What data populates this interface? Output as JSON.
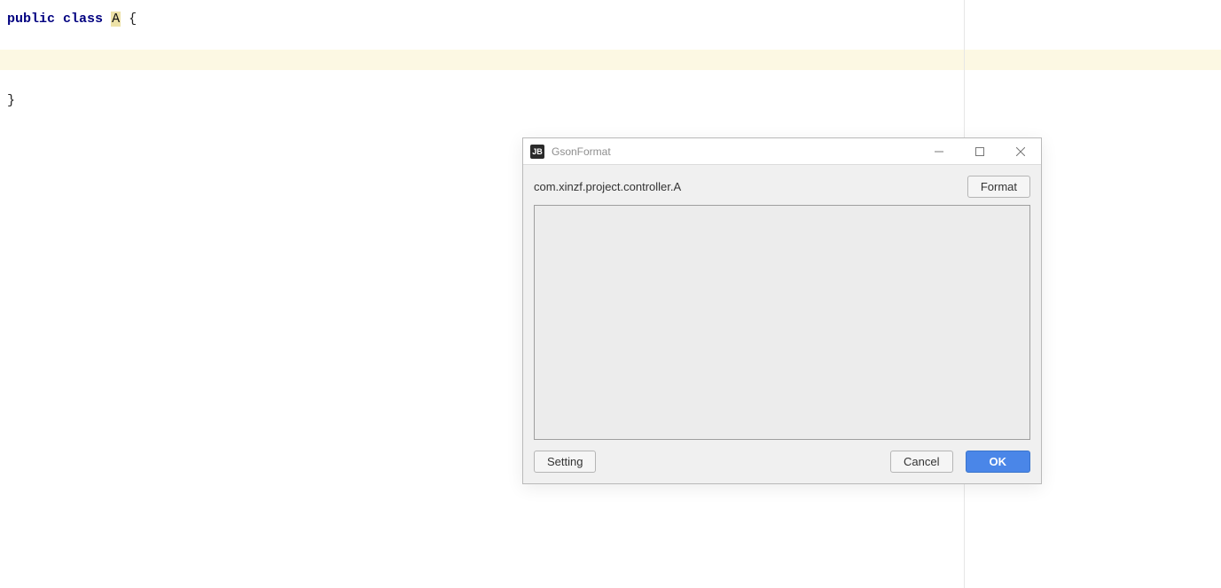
{
  "editor": {
    "line1_kw1": "public",
    "line1_kw2": "class",
    "line1_ident": "A",
    "line1_rest": " {",
    "line2": "",
    "line3": "",
    "line4": "",
    "line5": "}"
  },
  "dialog": {
    "icon_text": "JB",
    "title": "GsonFormat",
    "class_path": "com.xinzf.project.controller.A",
    "format_label": "Format",
    "json_value": "",
    "setting_label": "Setting",
    "cancel_label": "Cancel",
    "ok_label": "OK"
  }
}
